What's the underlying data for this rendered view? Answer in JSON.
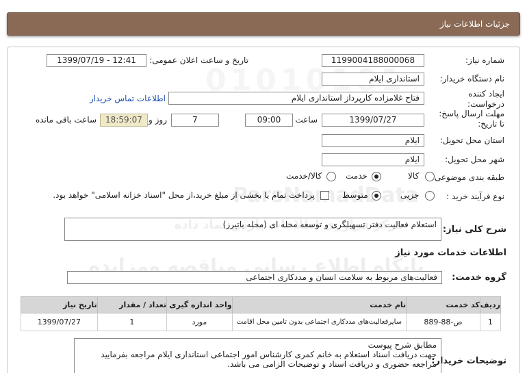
{
  "header": {
    "title": "جزئیات اطلاعات نیاز"
  },
  "form": {
    "need_number_label": "شماره نیاز:",
    "need_number": "1199004188000068",
    "announce_label": "تاریخ و ساعت اعلان عمومی:",
    "announce_value": "1399/07/19 - 12:41",
    "buyer_org_label": "نام دستگاه خریدار:",
    "buyer_org": "استانداری ایلام",
    "creator_label": "ایجاد کننده درخواست:",
    "creator": "فتاح غلامزاده کارپرداز استانداری ایلام",
    "contact_link": "اطلاعات تماس خریدار",
    "deadline_label": "مهلت ارسال پاسخ: تا تاریخ:",
    "deadline_date": "1399/07/27",
    "time_label": "ساعت",
    "deadline_time": "09:00",
    "days_value": "7",
    "day_label": "روز و",
    "remaining_time": "18:59:07",
    "remaining_label": "ساعت باقی مانده",
    "province_label": "استان محل تحویل:",
    "province": "ایلام",
    "city_label": "شهر محل تحویل:",
    "city": "ایلام",
    "category_label": "طبقه بندی موضوعی:",
    "category_options": [
      "کالا",
      "خدمت",
      "کالا/خدمت"
    ],
    "category_selected": "خدمت",
    "process_label": "نوع فرآیند خرید :",
    "process_options": [
      "جزیی",
      "متوسط"
    ],
    "process_selected": "متوسط",
    "payment_note": "پرداخت تمام یا بخشی از مبلغ خرید،از محل \"اسناد خزانه اسلامی\" خواهد بود."
  },
  "summary": {
    "label": "شرح کلی نیاز:",
    "text": "استعلام  فعالیت دفتر تسهیلگری و توسعه محله ای (محله باتیرز)"
  },
  "services": {
    "section_title": "اطلاعات خدمات مورد نیاز",
    "group_label": "گروه خدمت:",
    "group_value": "فعالیت‌های مربوط به سلامت انسان و مددکاری اجتماعی",
    "columns": [
      "ردیف",
      "کد خدمت",
      "نام خدمت",
      "واحد اندازه گیری",
      "تعداد / مقدار",
      "تاریخ نیاز"
    ],
    "rows": [
      [
        "1",
        "ص-88-889",
        "سایرفعالیت‌های مددکاری اجتماعی بدون تامین محل اقامت",
        "مورد",
        "1",
        "1399/07/27"
      ]
    ]
  },
  "buyer_notes": {
    "label": "توضیحات خریدار:",
    "lines": [
      "مطابق شرح پیوست",
      "جهت دریافت اسناد استعلام به خانم کمری کارشناس امور اجتماعی استانداری ایلام مراجعه بفرمایید",
      "مراجعه حضوری و دریافت اسناد و توضیحات الزامی می باشد."
    ]
  },
  "watermark": {
    "line1": "ParsNamadData",
    "line2": "مرکز فراوری اطلاعات پارس نماد داده",
    "line3": "پایگاه اطلاع رسانی مناقصه ومزایده",
    "line4": "۰۲۱-۸۸۳۴۹۶۷۰-۵"
  }
}
